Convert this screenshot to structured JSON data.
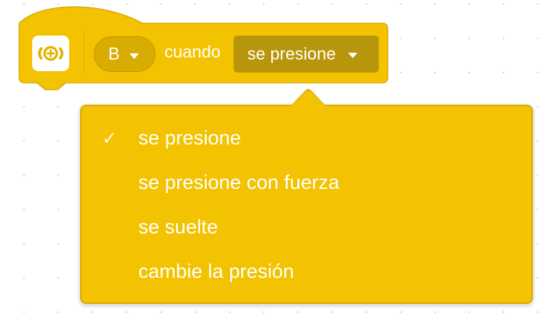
{
  "block": {
    "port_value": "B",
    "when_label": "cuando",
    "event_value": "se presione",
    "icon": "force-sensor-icon"
  },
  "menu": {
    "items": [
      {
        "label": "se presione",
        "selected": true
      },
      {
        "label": "se presione con fuerza",
        "selected": false
      },
      {
        "label": "se suelte",
        "selected": false
      },
      {
        "label": "cambie la presión",
        "selected": false
      }
    ],
    "check_glyph": "✓"
  },
  "colors": {
    "block_yellow": "#f3c200",
    "block_border": "#d9a900",
    "field_dark": "#b8960b",
    "text": "#ffffff"
  }
}
